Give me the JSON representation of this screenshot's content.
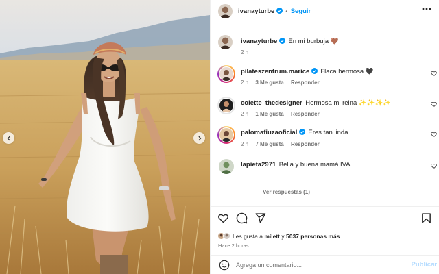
{
  "post": {
    "author": "ivanayturbe",
    "follow_label": "Seguir",
    "caption": "En mi burbuja 🤎",
    "caption_time": "2 h"
  },
  "comments": [
    {
      "user": "pilateszentrum.marice",
      "verified": true,
      "text": "Flaca hermosa 🖤",
      "time": "2 h",
      "likes": "3 Me gusta",
      "reply": "Responder"
    },
    {
      "user": "colette_thedesigner",
      "verified": false,
      "text": "Hermosa mi reina ✨✨✨✨",
      "time": "2 h",
      "likes": "1 Me gusta",
      "reply": "Responder"
    },
    {
      "user": "palomafiuzaoficial",
      "verified": true,
      "text": "Eres tan linda",
      "time": "2 h",
      "likes": "7 Me gusta",
      "reply": "Responder"
    },
    {
      "user": "lapieta2971",
      "verified": false,
      "text": "Bella y buena mamá IVA",
      "time": "",
      "likes": "",
      "reply": ""
    }
  ],
  "view_replies": "Ver respuestas (1)",
  "likes": {
    "prefix": "Les gusta a",
    "first_user": "milett",
    "middle": "y",
    "others": "5037 personas más"
  },
  "time_ago": "Hace 2 horas",
  "composer": {
    "placeholder": "Agrega un comentario...",
    "publish_label": "Publicar"
  },
  "icons": {
    "verified": "verified-badge-icon",
    "more": "more-options-icon",
    "like": "heart-icon",
    "comment": "comment-icon",
    "share": "share-icon",
    "save": "bookmark-icon",
    "emoji": "emoji-icon",
    "prev": "chevron-left-icon",
    "next": "chevron-right-icon"
  },
  "colors": {
    "accent": "#0095f6",
    "verified": "#0095f6",
    "publish_disabled": "#b3dbff",
    "muted": "#737373"
  }
}
